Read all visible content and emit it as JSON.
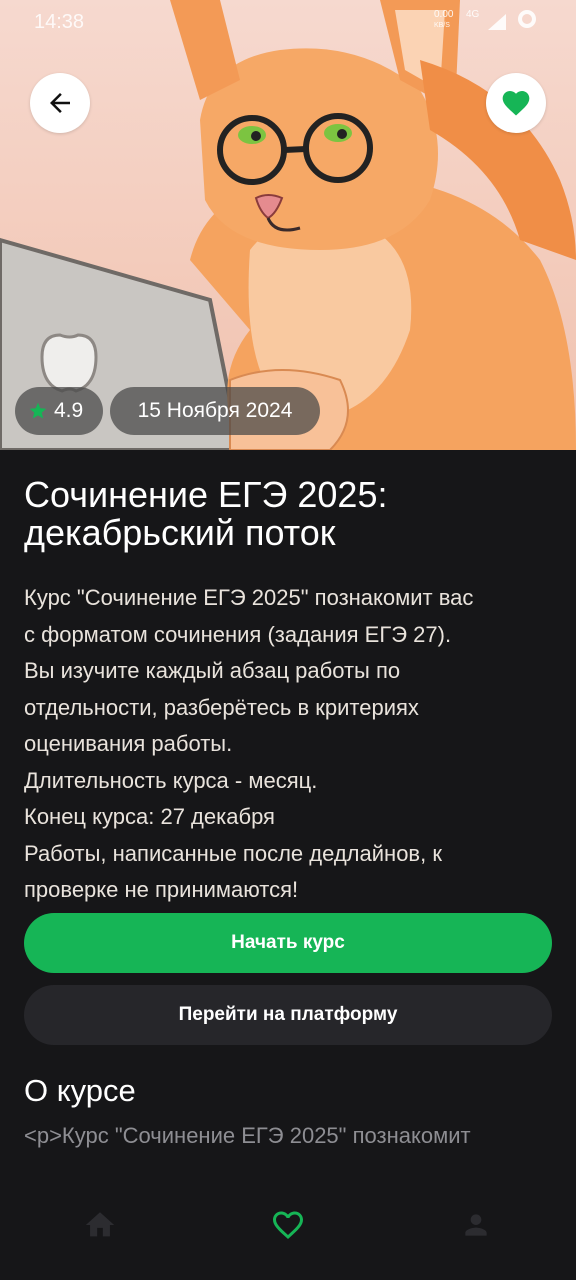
{
  "status_bar": {
    "time": "14:38",
    "net_speed_value": "0.00",
    "net_speed_unit": "KB/S",
    "network_type": "4G"
  },
  "hero": {
    "rating": "4.9",
    "date": "15 Ноября 2024"
  },
  "course": {
    "title_line1": "Сочинение ЕГЭ 2025:",
    "title_line2": "декабрьский поток",
    "description_lines": [
      "Курс \"Сочинение ЕГЭ 2025\" познакомит вас",
      "с форматом сочинения (задания ЕГЭ 27).",
      "Вы изучите каждый абзац работы по",
      "отдельности, разберётесь в критериях",
      "оценивания работы.",
      "Длительность курса - месяц.",
      "Конец курса: 27 декабря",
      "Работы, написанные после дедлайнов, к",
      "проверке не принимаются!"
    ]
  },
  "actions": {
    "start_label": "Начать курс",
    "platform_label": "Перейти на платформу"
  },
  "about": {
    "title": "О курсе",
    "text": "<p>Курс \"Сочинение ЕГЭ 2025\" познакомит"
  },
  "colors": {
    "accent": "#16b556",
    "background": "#161618",
    "secondary_button": "#26262a"
  },
  "icons": {
    "back": "arrow-left-icon",
    "favorite": "heart-filled-icon",
    "rating": "star-icon",
    "tab_home": "home-icon",
    "tab_favorites": "heart-outline-icon",
    "tab_profile": "person-icon"
  }
}
